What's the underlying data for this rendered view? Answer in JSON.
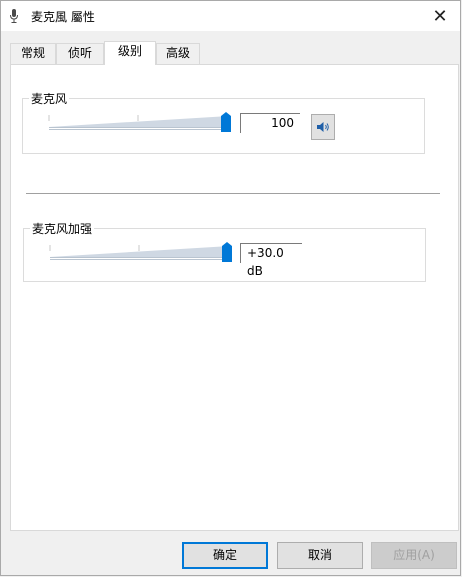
{
  "window": {
    "title": "麦克風 屬性",
    "close_glyph": "✕"
  },
  "tabs": [
    {
      "label": "常规",
      "active": false
    },
    {
      "label": "侦听",
      "active": false
    },
    {
      "label": "级别",
      "active": true
    },
    {
      "label": "高级",
      "active": false
    }
  ],
  "levels": {
    "microphone": {
      "label": "麦克风",
      "value_text": "100",
      "level": 1.0,
      "speaker_icon": "speaker-volume-icon"
    },
    "boost": {
      "label": "麦克风加强",
      "value_text": "+30.0 dB",
      "level": 1.0
    }
  },
  "buttons": {
    "ok": "确定",
    "cancel": "取消",
    "apply": "应用(A)"
  },
  "colors": {
    "accent": "#0078d7",
    "thumb": "#0078d7",
    "track": "#cfd8e3"
  }
}
